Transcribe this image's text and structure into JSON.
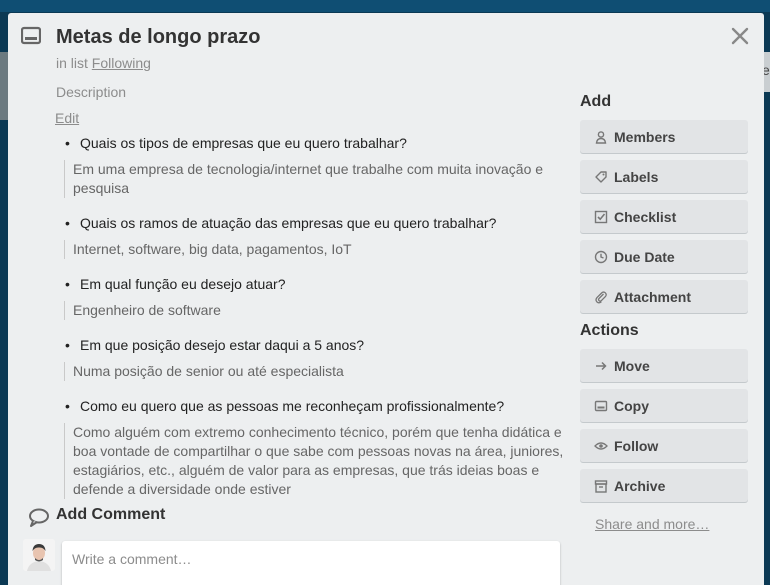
{
  "card": {
    "title": "Metas de longo prazo",
    "list_prefix": "in list",
    "list_name": "Following"
  },
  "background": {
    "right_fragment": "e"
  },
  "description": {
    "label": "Description",
    "edit_label": "Edit",
    "items": [
      {
        "question": "Quais os tipos de empresas que eu quero trabalhar?",
        "answer": "Em uma empresa de tecnologia/internet que trabalhe com muita inovação e pesquisa"
      },
      {
        "question": "Quais os ramos de atuação das empresas que eu quero trabalhar?",
        "answer": "Internet, software, big data, pagamentos, IoT"
      },
      {
        "question": "Em qual função eu desejo atuar?",
        "answer": "Engenheiro de software"
      },
      {
        "question": "Em que posição desejo estar daqui a 5 anos?",
        "answer": "Numa posição de senior ou até especialista"
      },
      {
        "question": "Como eu quero que as pessoas me reconheçam profissionalmente?",
        "answer": "Como alguém com extremo conhecimento técnico, porém que tenha didática e boa vontade de compartilhar o que sabe com pessoas novas na área, juniores, estagiários, etc., alguém de valor para as empresas, que trás ideias boas e defende a diversidade onde estiver"
      }
    ]
  },
  "comment": {
    "title": "Add Comment",
    "placeholder": "Write a comment…"
  },
  "sidebar": {
    "add_heading": "Add",
    "add_buttons": [
      {
        "label": "Members",
        "icon": "person-icon"
      },
      {
        "label": "Labels",
        "icon": "tag-icon"
      },
      {
        "label": "Checklist",
        "icon": "checkbox-icon"
      },
      {
        "label": "Due Date",
        "icon": "clock-icon"
      },
      {
        "label": "Attachment",
        "icon": "paperclip-icon"
      }
    ],
    "actions_heading": "Actions",
    "action_buttons": [
      {
        "label": "Move",
        "icon": "arrow-right-icon"
      },
      {
        "label": "Copy",
        "icon": "card-icon"
      },
      {
        "label": "Follow",
        "icon": "eye-icon"
      }
    ],
    "archive_label": "Archive",
    "share_label": "Share and more…"
  },
  "colors": {
    "board_background": "#0b3954",
    "modal_background": "#edeff0",
    "button_background": "#e2e4e6"
  }
}
